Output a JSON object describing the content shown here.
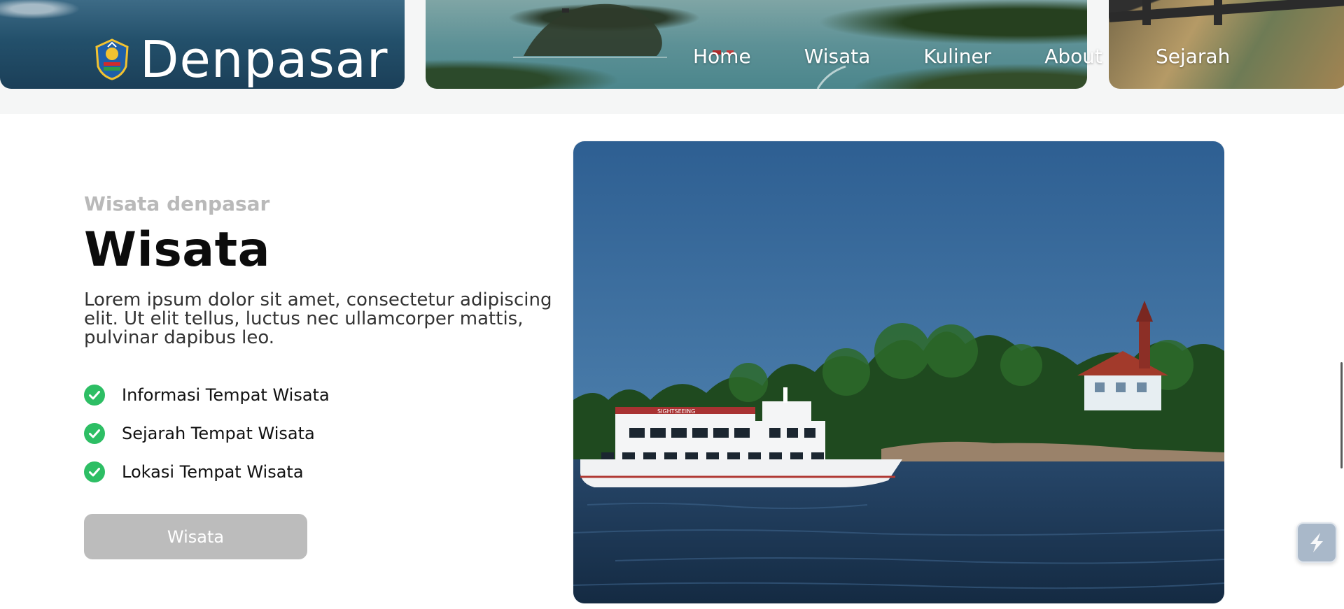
{
  "header": {
    "brand_title": "Denpasar",
    "nav": [
      {
        "label": "Home"
      },
      {
        "label": "Wisata"
      },
      {
        "label": "Kuliner"
      },
      {
        "label": "About"
      },
      {
        "label": "Sejarah"
      }
    ]
  },
  "section": {
    "eyebrow": "Wisata denpasar",
    "heading": "Wisata",
    "paragraph": "Lorem ipsum dolor sit amet, consectetur adipiscing elit. Ut elit tellus, luctus nec ullamcorper mattis, pulvinar dapibus leo.",
    "features": [
      {
        "label": "Informasi Tempat Wisata",
        "icon": "check-circle-icon"
      },
      {
        "label": "Sejarah Tempat Wisata",
        "icon": "check-circle-icon"
      },
      {
        "label": "Lokasi Tempat Wisata",
        "icon": "check-circle-icon"
      }
    ],
    "button_label": "Wisata",
    "boat_sign": "SIGHTSEEING"
  },
  "colors": {
    "check": "#2dbe64",
    "eyebrow": "#b9b9b9",
    "button": "#bcbcbc",
    "heading": "#0c0c0c"
  }
}
